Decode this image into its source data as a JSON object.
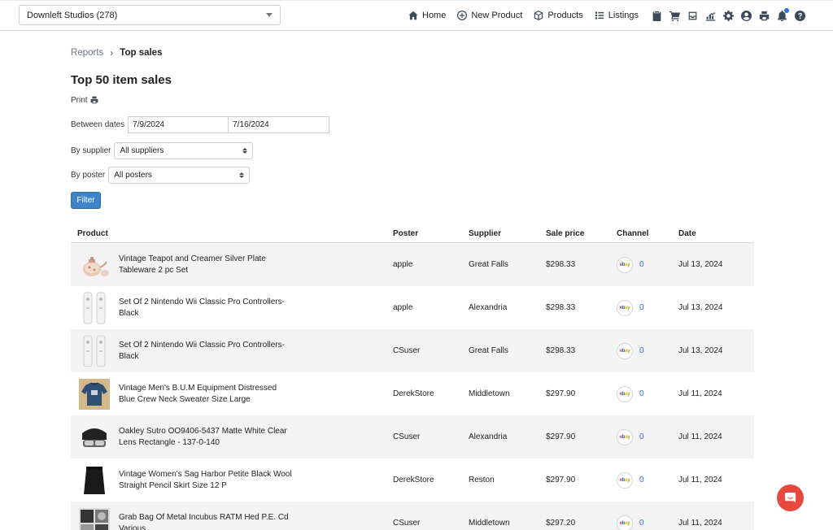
{
  "topbar": {
    "store_select": "Downleft Studios (278)",
    "nav": [
      {
        "label": "Home",
        "icon": "home-icon"
      },
      {
        "label": "New Product",
        "icon": "plus-circle-icon"
      },
      {
        "label": "Products",
        "icon": "cube-icon"
      },
      {
        "label": "Listings",
        "icon": "list-icon"
      }
    ],
    "icons": [
      "clipboard-icon",
      "cart-icon",
      "inbox-icon",
      "chart-icon",
      "gear-icon",
      "user-icon",
      "printer-icon",
      "bell-icon",
      "help-icon"
    ]
  },
  "breadcrumb": {
    "parent": "Reports",
    "separator": "›",
    "current": "Top sales"
  },
  "page": {
    "title": "Top 50 item sales",
    "print_label": "Print"
  },
  "filters": {
    "dates_label": "Between dates",
    "date_from": "7/9/2024",
    "date_to": "7/16/2024",
    "supplier_label": "By supplier",
    "supplier_value": "All suppliers",
    "poster_label": "By poster",
    "poster_value": "All posters",
    "filter_button": "Filter"
  },
  "table": {
    "headers": {
      "product": "Product",
      "poster": "Poster",
      "supplier": "Supplier",
      "price": "Sale price",
      "channel": "Channel",
      "date": "Date"
    },
    "rows": [
      {
        "product": "Vintage Teapot and Creamer Silver Plate Tableware 2 pc Set",
        "poster": "apple",
        "supplier": "Great Falls",
        "price": "$298.33",
        "channel_count": "0",
        "date": "Jul 13, 2024",
        "thumb": "teapot"
      },
      {
        "product": "Set Of 2 Nintendo Wii Classic Pro Controllers-Black",
        "poster": "apple",
        "supplier": "Alexandria",
        "price": "$298.33",
        "channel_count": "0",
        "date": "Jul 13, 2024",
        "thumb": "wii"
      },
      {
        "product": "Set Of 2 Nintendo Wii Classic Pro Controllers-Black",
        "poster": "CSuser",
        "supplier": "Great Falls",
        "price": "$298.33",
        "channel_count": "0",
        "date": "Jul 13, 2024",
        "thumb": "wii"
      },
      {
        "product": "Vintage Men's B.U.M Equipment Distressed Blue Crew Neck Sweater Size Large",
        "poster": "DerekStore",
        "supplier": "Middletown",
        "price": "$297.90",
        "channel_count": "0",
        "date": "Jul 11, 2024",
        "thumb": "sweater"
      },
      {
        "product": "Oakley Sutro OO9406-5437 Matte White Clear Lens Rectangle - 137-0-140",
        "poster": "CSuser",
        "supplier": "Alexandria",
        "price": "$297.90",
        "channel_count": "0",
        "date": "Jul 11, 2024",
        "thumb": "glasses"
      },
      {
        "product": "Vintage Women's Sag Harbor Petite Black Wool Straight Pencil Skirt Size 12 P",
        "poster": "DerekStore",
        "supplier": "Reston",
        "price": "$297.90",
        "channel_count": "0",
        "date": "Jul 11, 2024",
        "thumb": "skirt"
      },
      {
        "product": "Grab Bag Of Metal Incubus RATM Hed P.E. Cd Various",
        "poster": "CSuser",
        "supplier": "Middletown",
        "price": "$297.20",
        "channel_count": "0",
        "date": "Jul 11, 2024",
        "thumb": "cds"
      }
    ]
  },
  "channel_badge_text": "ebay",
  "colors": {
    "accent": "#3f84c6",
    "link": "#2f6fd6",
    "chat": "#e8493f"
  }
}
